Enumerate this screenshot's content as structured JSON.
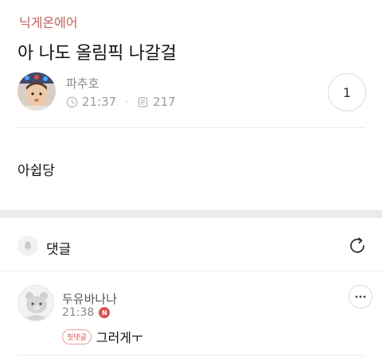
{
  "board": {
    "name": "닉게온에어"
  },
  "post": {
    "title": "아 나도 올림픽 나갈걸",
    "author": "파추호",
    "time": "21:37",
    "views": "217",
    "comment_count": "1",
    "body": "아쉽당"
  },
  "comments_section": {
    "label": "댓글",
    "items": [
      {
        "author": "두유바나나",
        "time": "21:38",
        "new_badge": "N",
        "first_badge": "첫댓글",
        "text": "그러게ㅜ"
      }
    ]
  },
  "icons": {
    "time": "clock-icon",
    "views": "document-icon",
    "notify": "bell-icon",
    "refresh": "refresh-icon",
    "more": "more-icon"
  },
  "colors": {
    "board_accent": "#c2615f",
    "badge_red": "#d9534f",
    "muted_text": "#9a9a9a",
    "divider": "#ececec"
  }
}
